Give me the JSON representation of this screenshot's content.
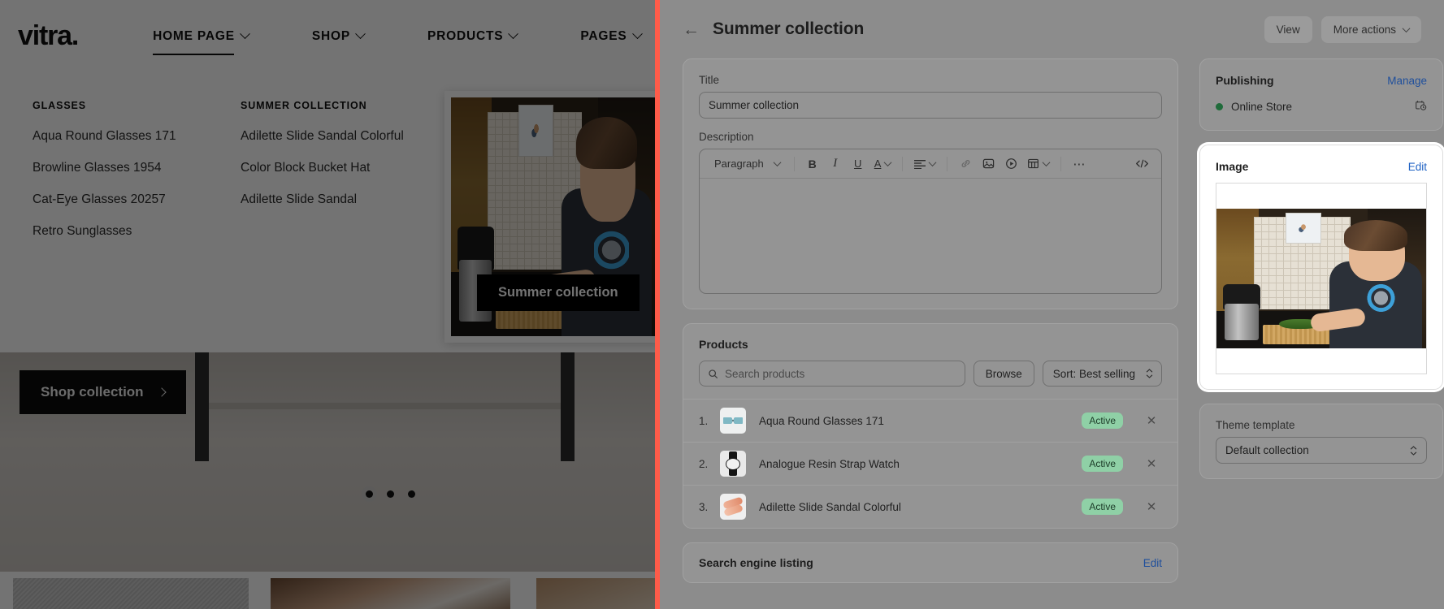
{
  "storefront": {
    "logo": "vitra.",
    "nav": [
      {
        "label": "HOME PAGE",
        "has_chevron": true,
        "active": true
      },
      {
        "label": "SHOP",
        "has_chevron": true,
        "active": false
      },
      {
        "label": "PRODUCTS",
        "has_chevron": true,
        "active": false
      },
      {
        "label": "PAGES",
        "has_chevron": true,
        "active": false
      }
    ],
    "megamenu": {
      "columns": [
        {
          "heading": "GLASSES",
          "items": [
            "Aqua Round Glasses 171",
            "Browline Glasses 1954",
            "Cat-Eye Glasses 20257",
            "Retro Sunglasses"
          ]
        },
        {
          "heading": "SUMMER COLLECTION",
          "items": [
            "Adilette Slide Sandal Colorful",
            "Color Block Bucket Hat",
            "Adilette Slide Sandal"
          ]
        }
      ],
      "feature_card_label": "Summer collection"
    },
    "hero": {
      "cta_label": "Shop collection",
      "cta_arrow": "chevron-right-icon",
      "carousel_dots": 3,
      "active_dot": 1
    }
  },
  "admin": {
    "header": {
      "back_icon": "arrow-left-icon",
      "title": "Summer collection",
      "view_label": "View",
      "more_actions_label": "More actions"
    },
    "title_field": {
      "label": "Title",
      "value": "Summer collection"
    },
    "description_field": {
      "label": "Description",
      "value": "",
      "toolbar": {
        "paragraph_label": "Paragraph",
        "bold": "bold-icon",
        "italic": "italic-icon",
        "underline": "underline-icon",
        "text_color": "text-color-icon",
        "align": "align-left-icon",
        "link": "link-icon",
        "image": "insert-image-icon",
        "video": "insert-video-icon",
        "table": "insert-table-icon",
        "more": "more-horizontal-icon",
        "code": "code-icon"
      }
    },
    "products": {
      "heading": "Products",
      "search_placeholder": "Search products",
      "search_value": "",
      "search_icon": "search-icon",
      "browse_label": "Browse",
      "sort_label": "Sort: Best selling",
      "rows": [
        {
          "index": "1.",
          "name": "Aqua Round Glasses 171",
          "status": "Active",
          "remove_icon": "close-icon"
        },
        {
          "index": "2.",
          "name": "Analogue Resin Strap Watch",
          "status": "Active",
          "remove_icon": "close-icon"
        },
        {
          "index": "3.",
          "name": "Adilette Slide Sandal Colorful",
          "status": "Active",
          "remove_icon": "close-icon"
        }
      ]
    },
    "seo": {
      "heading": "Search engine listing",
      "edit_label": "Edit"
    },
    "sidebar": {
      "publishing": {
        "heading": "Publishing",
        "manage_label": "Manage",
        "channel": "Online Store",
        "status_color": "#1f6b3a",
        "schedule_icon": "calendar-clock-icon"
      },
      "image": {
        "heading": "Image",
        "edit_label": "Edit"
      },
      "theme_template": {
        "label": "Theme template",
        "value": "Default collection"
      }
    }
  },
  "colors": {
    "accent_border": "#ff5b49",
    "link": "#1f62c4",
    "badge_active_bg": "#8fd0a6",
    "panel_bg": "#8c8c8c"
  }
}
